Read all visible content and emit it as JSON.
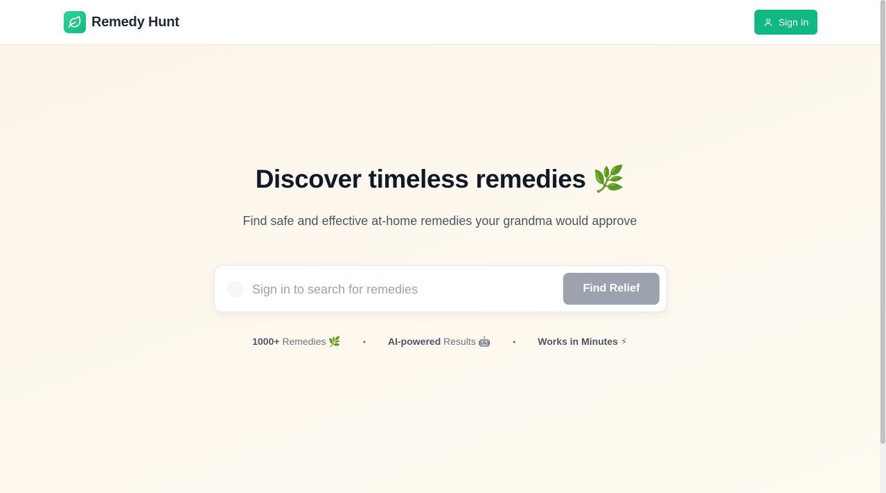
{
  "header": {
    "brand_name": "Remedy Hunt",
    "signin_label": "Sign In"
  },
  "hero": {
    "title": "Discover timeless remedies 🌿",
    "subtitle": "Find safe and effective at-home remedies your grandma would approve"
  },
  "search": {
    "placeholder": "Sign in to search for remedies",
    "value": "",
    "button_label": "Find Relief"
  },
  "features": [
    {
      "bold": "1000+",
      "text": " Remedies 🌿"
    },
    {
      "bold": "AI-powered",
      "text": " Results 🤖"
    },
    {
      "bold": "Works in Minutes",
      "text": " ⚡"
    }
  ],
  "separator": "•",
  "colors": {
    "brand_green": "#10b981",
    "disabled_gray": "#9ca3af",
    "title_text": "#111827"
  },
  "icons": {
    "logo": "leaf-icon",
    "signin": "user-icon",
    "search": "search-icon"
  }
}
